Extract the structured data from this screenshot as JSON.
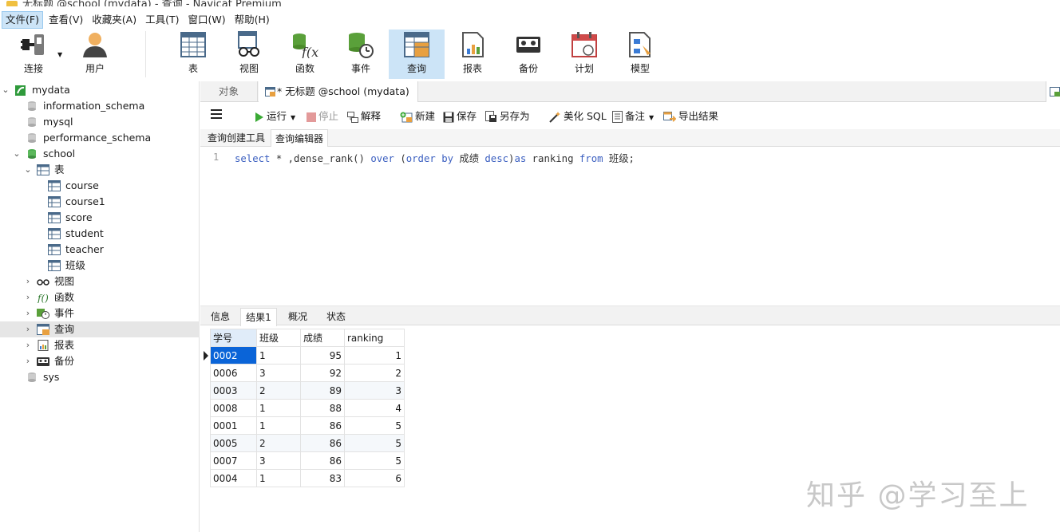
{
  "window": {
    "title": "无标题 @school (mydata) - 查询 - Navicat Premium"
  },
  "menu": [
    "文件(F)",
    "查看(V)",
    "收藏夹(A)",
    "工具(T)",
    "窗口(W)",
    "帮助(H)"
  ],
  "toolbar": {
    "connect": "连接",
    "user": "用户",
    "table": "表",
    "view": "视图",
    "function": "函数",
    "event": "事件",
    "query": "查询",
    "report": "报表",
    "backup": "备份",
    "schedule": "计划",
    "model": "模型"
  },
  "tree": {
    "mydata": "mydata",
    "information_schema": "information_schema",
    "mysql": "mysql",
    "performance_schema": "performance_schema",
    "school": "school",
    "tables": "表",
    "table_items": [
      "course",
      "course1",
      "score",
      "student",
      "teacher",
      "班级"
    ],
    "views": "视图",
    "functions": "函数",
    "events": "事件",
    "queries": "查询",
    "reports": "报表",
    "backups": "备份",
    "sys": "sys"
  },
  "doc_tabs": {
    "objects": "对象",
    "query_tab": "* 无标题 @school (mydata) -..."
  },
  "query_toolbar": {
    "run": "运行",
    "stop": "停止",
    "explain": "解释",
    "new": "新建",
    "save": "保存",
    "save_as": "另存为",
    "beautify": "美化 SQL",
    "comment": "备注",
    "export": "导出结果"
  },
  "sub_tabs": {
    "builder": "查询创建工具",
    "editor": "查询编辑器"
  },
  "editor": {
    "line_number": "1",
    "sql": "select * ,dense_rank() over (order by 成绩 desc)as ranking from 班级;"
  },
  "result_tabs": [
    "信息",
    "结果1",
    "概况",
    "状态"
  ],
  "result": {
    "columns": [
      "学号",
      "班级",
      "成绩",
      "ranking"
    ],
    "rows": [
      [
        "0002",
        "1",
        "95",
        "1"
      ],
      [
        "0006",
        "3",
        "92",
        "2"
      ],
      [
        "0003",
        "2",
        "89",
        "3"
      ],
      [
        "0008",
        "1",
        "88",
        "4"
      ],
      [
        "0001",
        "1",
        "86",
        "5"
      ],
      [
        "0005",
        "2",
        "86",
        "5"
      ],
      [
        "0007",
        "3",
        "86",
        "5"
      ],
      [
        "0004",
        "1",
        "83",
        "6"
      ]
    ]
  },
  "watermark": "知乎 @学习至上",
  "colors": {
    "accent": "#0a64d8",
    "selected_toolbar": "#cce4f7",
    "keyword": "#3b5fc0"
  }
}
